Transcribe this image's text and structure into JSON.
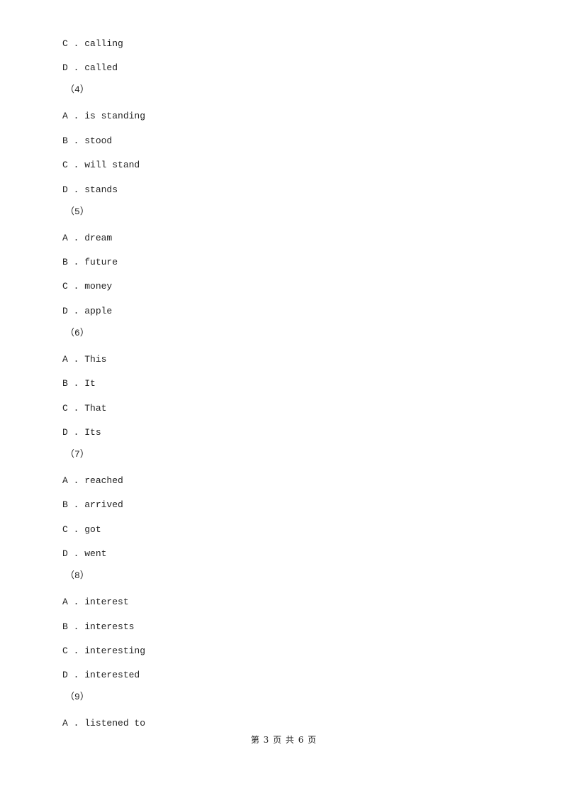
{
  "content": {
    "q3_tail": [
      {
        "letter": "C",
        "text": "calling"
      },
      {
        "letter": "D",
        "text": "called"
      }
    ],
    "questions": [
      {
        "number": "（4）",
        "options": [
          {
            "letter": "A",
            "text": "is standing"
          },
          {
            "letter": "B",
            "text": "stood"
          },
          {
            "letter": "C",
            "text": "will stand"
          },
          {
            "letter": "D",
            "text": "stands"
          }
        ]
      },
      {
        "number": "（5）",
        "options": [
          {
            "letter": "A",
            "text": "dream"
          },
          {
            "letter": "B",
            "text": "future"
          },
          {
            "letter": "C",
            "text": "money"
          },
          {
            "letter": "D",
            "text": "apple"
          }
        ]
      },
      {
        "number": "（6）",
        "options": [
          {
            "letter": "A",
            "text": "This"
          },
          {
            "letter": "B",
            "text": "It"
          },
          {
            "letter": "C",
            "text": "That"
          },
          {
            "letter": "D",
            "text": "Its"
          }
        ]
      },
      {
        "number": "（7）",
        "options": [
          {
            "letter": "A",
            "text": "reached"
          },
          {
            "letter": "B",
            "text": "arrived"
          },
          {
            "letter": "C",
            "text": "got"
          },
          {
            "letter": "D",
            "text": "went"
          }
        ]
      },
      {
        "number": "（8）",
        "options": [
          {
            "letter": "A",
            "text": "interest"
          },
          {
            "letter": "B",
            "text": "interests"
          },
          {
            "letter": "C",
            "text": "interesting"
          },
          {
            "letter": "D",
            "text": "interested"
          }
        ]
      },
      {
        "number": "（9）",
        "options": [
          {
            "letter": "A",
            "text": "listened to"
          }
        ]
      }
    ]
  },
  "footer": {
    "page_label": "第 3 页 共 6 页"
  }
}
